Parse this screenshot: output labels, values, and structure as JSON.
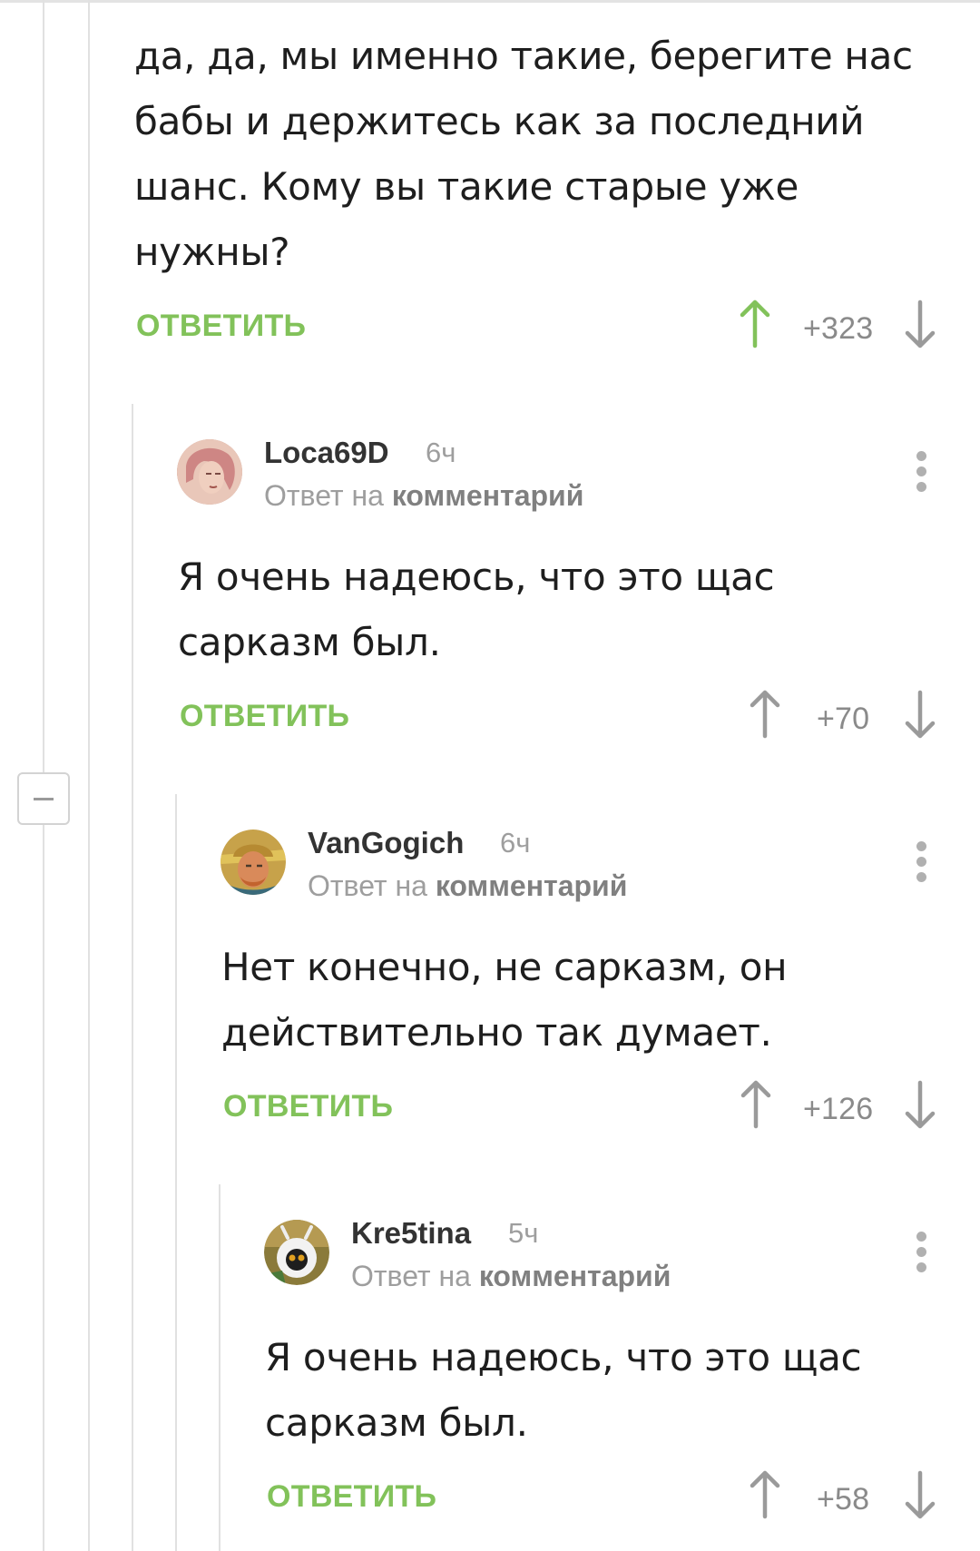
{
  "colors": {
    "reply_green": "#82c25a",
    "upvote_active": "#82c25a",
    "vote_gray": "#9a9a9a",
    "thread_line": "#e1e1e1"
  },
  "reply_label": "ОТВЕТИТЬ",
  "answer_prefix": "Ответ на",
  "answer_link": "комментарий",
  "comments": [
    {
      "lines": [
        "да, да, мы именно такие, берегите нас",
        "бабы и держитесь как за последний",
        "шанс. Кому вы такие старые уже",
        "нужны?"
      ],
      "score": "+323",
      "upvoted": true
    },
    {
      "user": "Loca69D",
      "time": "6ч",
      "avatar": "woman-portrait-avatar",
      "lines": [
        "Я очень надеюсь, что это щас",
        "сарказм был."
      ],
      "score": "+70",
      "upvoted": false
    },
    {
      "user": "VanGogich",
      "time": "6ч",
      "avatar": "van-gogh-portrait-avatar",
      "lines": [
        "Нет конечно, не сарказм, он",
        "действительно так думает."
      ],
      "score": "+126",
      "upvoted": false
    },
    {
      "user": "Kre5tina",
      "time": "5ч",
      "avatar": "lemur-avatar",
      "lines": [
        "Я очень надеюсь, что это щас",
        "сарказм был."
      ],
      "score": "+58",
      "upvoted": false
    }
  ]
}
